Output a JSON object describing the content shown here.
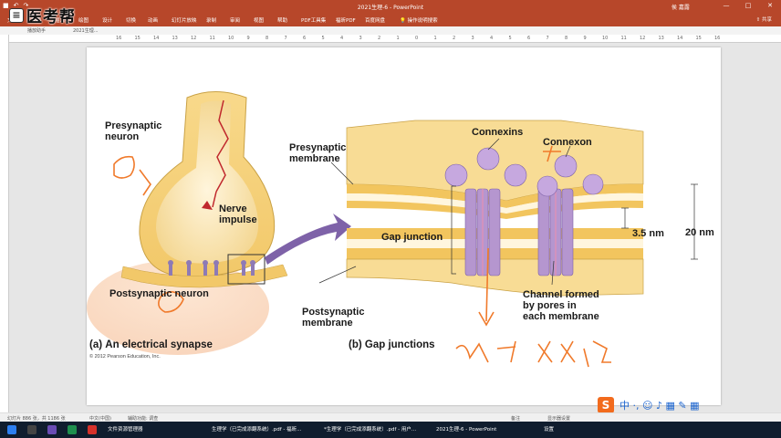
{
  "window": {
    "title": "2021生理-6  -  PowerPoint",
    "user": "侯 嘉露"
  },
  "window_controls": [
    "—",
    "□",
    "✕"
  ],
  "watermark": {
    "logo": "≡",
    "text": "医考帮"
  },
  "ribbon": {
    "tabs": [
      "文件",
      "开始",
      "插入",
      "绘图",
      "设计",
      "切换",
      "动画",
      "幻灯片放映",
      "录制",
      "审阅",
      "视图",
      "帮助",
      "PDF工具集",
      "福昕PDF",
      "百度网盘",
      "操作说明搜索"
    ],
    "share": "共享"
  },
  "doctabs": [
    "播放助手",
    "2021生理..."
  ],
  "ruler": {
    "left_ticks": [
      "16",
      "15",
      "14",
      "13",
      "12",
      "11",
      "10",
      "9",
      "8",
      "7",
      "6",
      "5",
      "4",
      "3",
      "2",
      "1",
      "0"
    ],
    "right_ticks": [
      "1",
      "2",
      "3",
      "4",
      "5",
      "6",
      "7",
      "8",
      "9",
      "10",
      "11",
      "12",
      "13",
      "14",
      "15",
      "16"
    ]
  },
  "slide": {
    "left": {
      "labels": {
        "presynaptic": "Presynaptic\nneuron",
        "nerve_impulse": "Nerve\nimpulse",
        "postsynaptic": "Postsynaptic neuron"
      },
      "caption_letter": "(a)",
      "caption_text": "An electrical synapse",
      "copyright": "© 2012 Pearson Education, Inc."
    },
    "right": {
      "labels": {
        "connexins": "Connexins",
        "connexon": "Connexon",
        "presynaptic_membrane": "Presynaptic\nmembrane",
        "gap_junction": "Gap junction",
        "gap_size": "3.5 nm",
        "total_size": "20 nm",
        "postsynaptic_membrane": "Postsynaptic\nmembrane",
        "channel": "Channel formed\nby pores in\neach membrane"
      },
      "caption_letter": "(b)",
      "caption_text": "Gap junctions"
    },
    "handwriting": {
      "left_top": "单",
      "left_bottom": "向",
      "bottom_right": "快速  双向"
    }
  },
  "statusbar": {
    "slide_info": "幻灯片 886 张，共 1186 张",
    "lang": "中文(中国)",
    "accessibility": "辅助功能: 调查",
    "notes": "备注",
    "view_settings": "显示器设置"
  },
  "taskbar": {
    "items": [
      "文件资源管理器",
      "生理学（已完成添翻系统）.pdf - 福昕...",
      "*生理学（已完成添翻系统）.pdf - 用户...",
      "2021生理-6 - PowerPoint",
      "设置"
    ]
  },
  "ime": {
    "logo": "S",
    "text": "中 ·, ☺ ♪ ▦ ✎ ▦"
  }
}
